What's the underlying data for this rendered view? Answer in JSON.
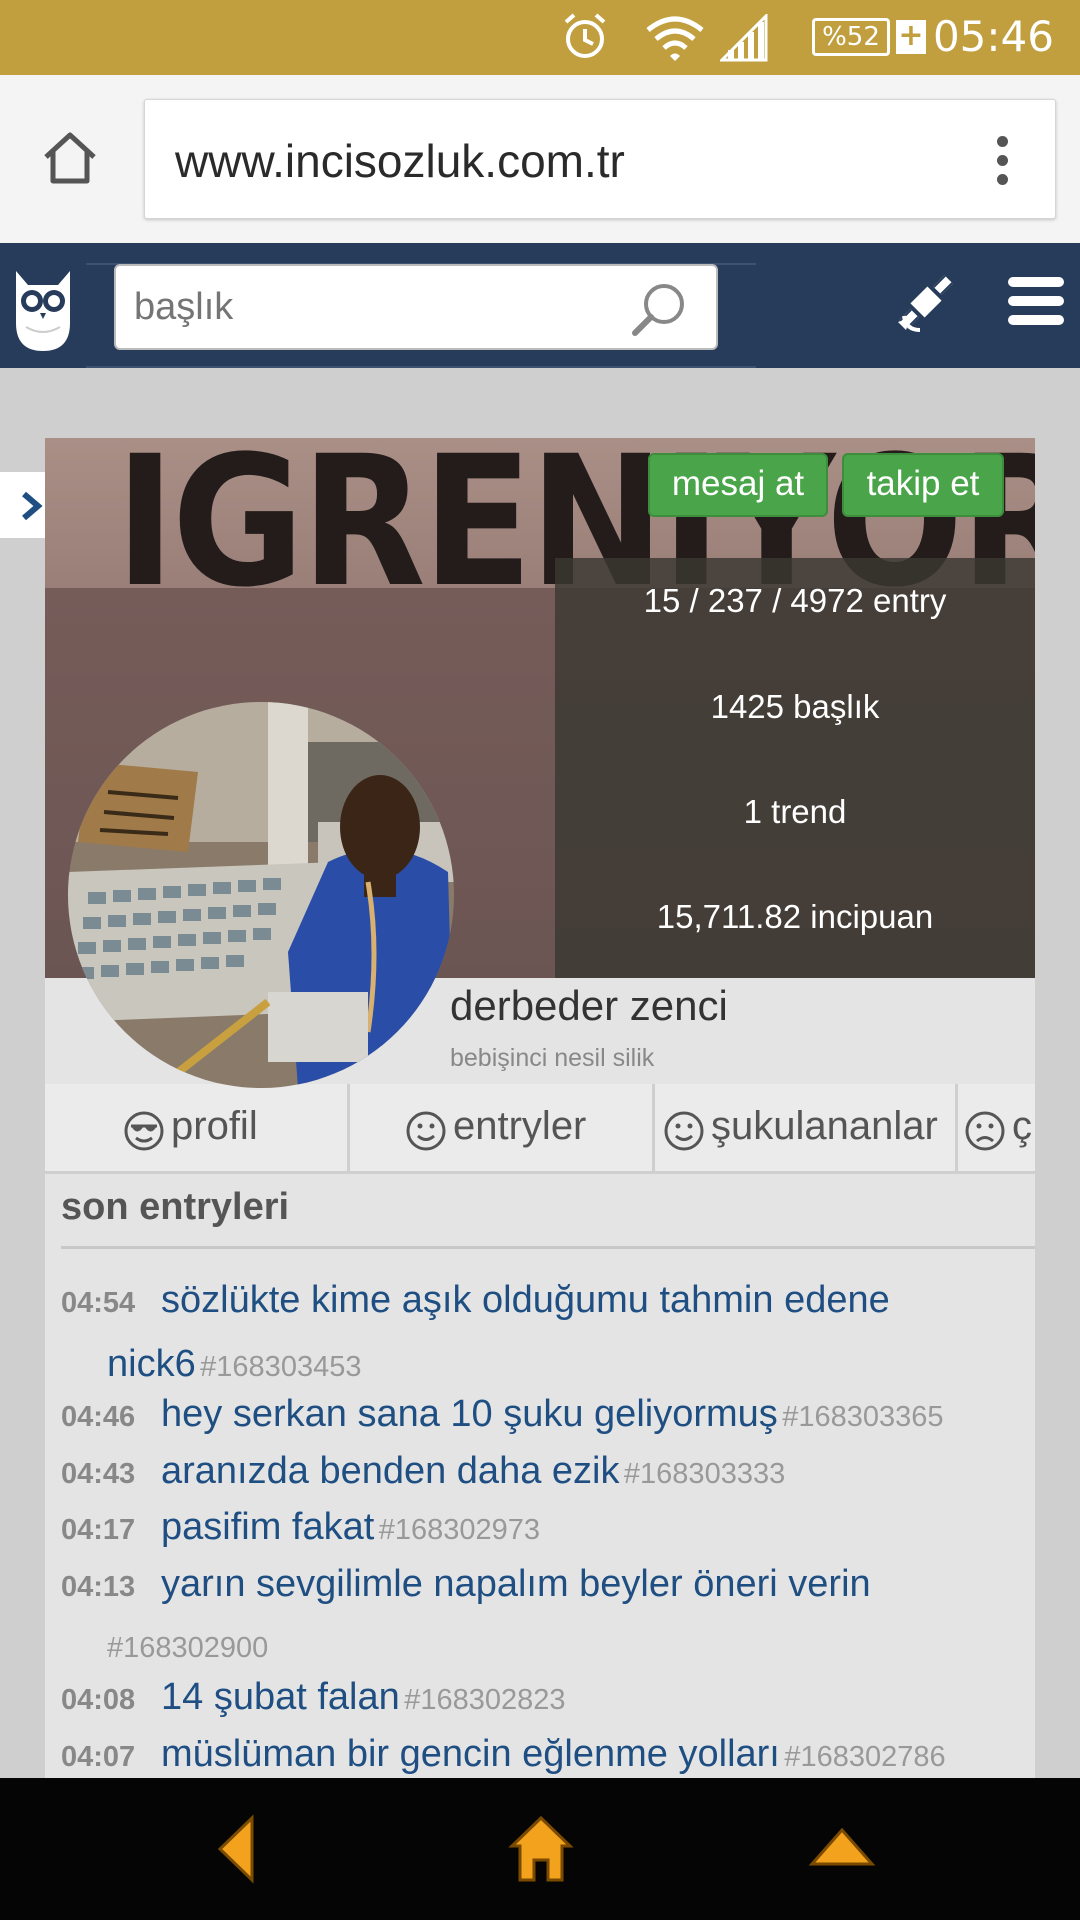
{
  "status_bar": {
    "battery": "%52",
    "time": "05:46",
    "icons": [
      "alarm-icon",
      "wifi-icon",
      "signal-icon",
      "battery-icon",
      "charging-icon"
    ]
  },
  "browser": {
    "url": "www.incisozluk.com.tr",
    "icons": [
      "home-icon",
      "overflow-menu-icon"
    ]
  },
  "site_header": {
    "search_placeholder": "başlık",
    "icons": [
      "owl-logo-icon",
      "search-icon",
      "satellite-icon",
      "hamburger-menu-icon"
    ]
  },
  "profile": {
    "cover_text": "IGRENIYOR",
    "message_button": "mesaj at",
    "follow_button": "takip et",
    "stats": {
      "entries": "15 / 237 / 4972 entry",
      "topics": "1425 başlık",
      "trend": "1 trend",
      "points": "15,711.82 incipuan"
    },
    "username": "derbeder zenci",
    "user_title": "bebişinci nesil silik"
  },
  "tabs": [
    {
      "label": "profil",
      "icon": "cool-face-icon"
    },
    {
      "label": "entryler",
      "icon": "smile-icon"
    },
    {
      "label": "şukulananlar",
      "icon": "smile-icon"
    },
    {
      "label": "ç",
      "icon": "sad-face-icon"
    }
  ],
  "section_title": "son entryleri",
  "entries": [
    {
      "time": "04:54",
      "title": "sözlükte kime aşık olduğumu tahmin edene",
      "title_cont": "nick6",
      "id": "#168303453"
    },
    {
      "time": "04:46",
      "title": "hey serkan sana 10 şuku geliyormuş",
      "id": "#168303365"
    },
    {
      "time": "04:43",
      "title": "aranızda benden daha ezik",
      "id": "#168303333"
    },
    {
      "time": "04:17",
      "title": "pasifim fakat",
      "id": "#168302973"
    },
    {
      "time": "04:13",
      "title": "yarın sevgilimle napalım beyler öneri verin",
      "id": "#168302900"
    },
    {
      "time": "04:08",
      "title": "14 şubat falan",
      "id": "#168302823"
    },
    {
      "time": "04:07",
      "title": "müslüman bir gencin eğlenme yolları",
      "id": "#168302786"
    }
  ],
  "nav_bar": {
    "icons": [
      "back-icon",
      "home-icon",
      "scroll-top-icon"
    ],
    "accent": "#f2a21c"
  }
}
